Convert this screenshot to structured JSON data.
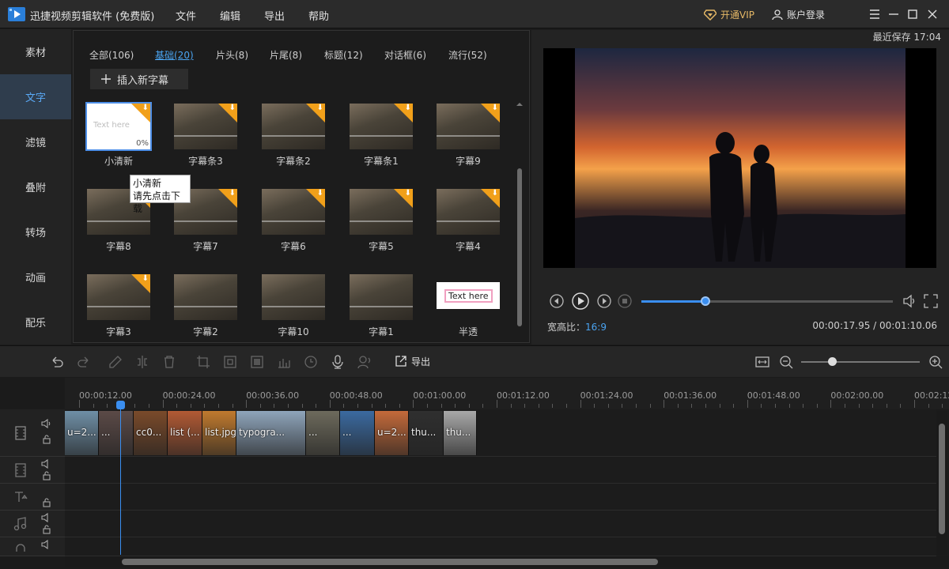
{
  "app": {
    "title": "迅捷视频剪辑软件 (免费版)",
    "menu": [
      "文件",
      "编辑",
      "导出",
      "帮助"
    ],
    "vip_label": "开通VIP",
    "account_label": "账户登录"
  },
  "sidebar": {
    "items": [
      {
        "label": "素材"
      },
      {
        "label": "文字"
      },
      {
        "label": "滤镜"
      },
      {
        "label": "叠附"
      },
      {
        "label": "转场"
      },
      {
        "label": "动画"
      },
      {
        "label": "配乐"
      }
    ],
    "active": "文字"
  },
  "library": {
    "tabs": [
      {
        "label": "全部(106)"
      },
      {
        "label": "基础(20)"
      },
      {
        "label": "片头(8)"
      },
      {
        "label": "片尾(8)"
      },
      {
        "label": "标题(12)"
      },
      {
        "label": "对话框(6)"
      },
      {
        "label": "流行(52)"
      }
    ],
    "active_tab": "基础(20)",
    "insert_button": "插入新字幕",
    "items": [
      {
        "label": "小清新",
        "thumb_text": "Text  here",
        "progress": "0%"
      },
      {
        "label": "字幕条3"
      },
      {
        "label": "字幕条2"
      },
      {
        "label": "字幕条1"
      },
      {
        "label": "字幕9"
      },
      {
        "label": "字幕8"
      },
      {
        "label": "字幕7"
      },
      {
        "label": "字幕6"
      },
      {
        "label": "字幕5"
      },
      {
        "label": "字幕4"
      },
      {
        "label": "字幕3"
      },
      {
        "label": "字幕2"
      },
      {
        "label": "字幕10"
      },
      {
        "label": "字幕1"
      },
      {
        "label": "半透",
        "thumb_text": "Text here"
      }
    ],
    "tooltip": {
      "line1": "小清新",
      "line2": "请先点击下载"
    }
  },
  "preview": {
    "save_status": "最近保存 17:04",
    "aspect_label": "宽高比：",
    "aspect_value": "16:9",
    "timecode": "00:00:17.95 / 00:01:10.06",
    "progress_fraction": 0.256
  },
  "toolbar": {
    "export_label": "导出",
    "zoom_fraction": 0.26
  },
  "ruler": {
    "labels": [
      "00:00:12.00",
      "00:00:24.00",
      "00:00:36.00",
      "00:00:48.00",
      "00:01:00.00",
      "00:01:12.00",
      "00:01:24.00",
      "00:01:36.00",
      "00:01:48.00",
      "00:02:00.00",
      "00:02:12.00"
    ]
  },
  "timeline": {
    "clips": [
      {
        "label": "u=2...",
        "color": "#6f8fa6"
      },
      {
        "label": "...",
        "color": "#5b4a47"
      },
      {
        "label": "cc0...",
        "color": "#7a4a2a"
      },
      {
        "label": "list (...",
        "color": "#b25a34"
      },
      {
        "label": "list.jpg",
        "color": "#c07a2e"
      },
      {
        "label": "typogra...",
        "color": "#8fa5bb"
      },
      {
        "label": "...",
        "color": "#6d6a5c"
      },
      {
        "label": "...",
        "color": "#3b6aa0"
      },
      {
        "label": "u=2...",
        "color": "#c46a3a"
      },
      {
        "label": "thu...",
        "color": "#2f2f2f"
      },
      {
        "label": "thu...",
        "color": "#a8a8a8"
      }
    ]
  }
}
